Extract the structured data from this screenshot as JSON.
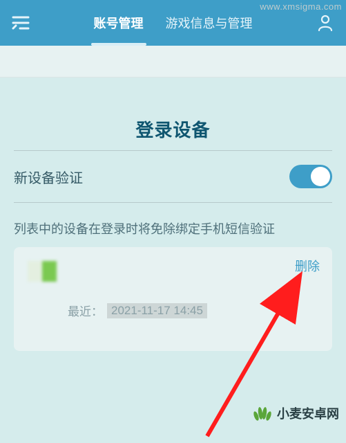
{
  "header": {
    "tabs": [
      {
        "label": "账号管理",
        "active": true
      },
      {
        "label": "游戏信息与管理",
        "active": false
      }
    ]
  },
  "page": {
    "title": "登录设备",
    "new_device_verify_label": "新设备验证",
    "help_text": "列表中的设备在登录时将免除绑定手机短信验证"
  },
  "device": {
    "delete_label": "删除",
    "recent_prefix": "最近：",
    "recent_datetime": "2021-11-17 14:45"
  },
  "watermarks": {
    "top_right": "www.xmsigma.com",
    "brand": "小麦安卓网"
  },
  "toggles": {
    "new_device_verify": true
  },
  "colors": {
    "accent": "#3e9ec8",
    "title": "#0f5670"
  }
}
